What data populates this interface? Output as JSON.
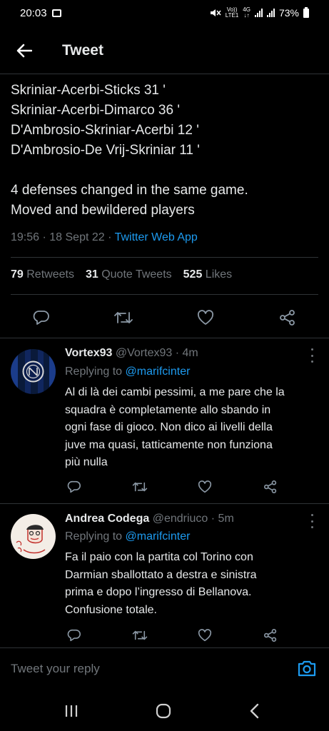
{
  "status_bar": {
    "time": "20:03",
    "volte": "Vo))",
    "lte": "LTE1",
    "network": "4G",
    "battery": "73%"
  },
  "header": {
    "title": "Tweet",
    "back_icon": "arrow-left-icon"
  },
  "tweet": {
    "lines": [
      "Skriniar-Acerbi-Sticks 31 '",
      "Skriniar-Acerbi-Dimarco 36 '",
      "D'Ambrosio-Skriniar-Acerbi 12 '",
      "D'Ambrosio-De Vrij-Skriniar 11 '",
      "4 defenses changed in the same game.",
      "Moved and bewildered players"
    ],
    "timestamp": "19:56 · 18 Sept 22 · ",
    "source": "Twitter Web App",
    "stats": {
      "retweets_count": "79",
      "retweets_label": "Retweets",
      "quotes_count": "31",
      "quotes_label": "Quote Tweets",
      "likes_count": "525",
      "likes_label": "Likes"
    }
  },
  "replies": [
    {
      "name": "Vortex93",
      "handle": "@Vortex93",
      "time": "· 4m",
      "replying_label": "Replying to ",
      "replying_to": "@marifcinter",
      "text_lines": [
        "Al di là dei cambi pessimi, a me pare che la",
        "squadra è completamente allo sbando in",
        "ogni fase di gioco. Non dico ai livelli della",
        "juve ma quasi, tatticamente non funziona",
        "più nulla"
      ]
    },
    {
      "name": "Andrea Codega",
      "handle": "@endriuco",
      "time": "· 5m",
      "replying_label": "Replying to ",
      "replying_to": "@marifcinter",
      "text_lines": [
        "Fa il paio con la partita col Torino con",
        "Darmian sballottato a destra e sinistra",
        "prima e dopo l’ingresso di Bellanova.",
        "Confusione totale."
      ]
    }
  ],
  "composer": {
    "placeholder": "Tweet your reply"
  },
  "colors": {
    "background": "#000000",
    "accent": "#1d9bf0",
    "text_primary": "#e7e9ea",
    "text_secondary": "#71767b",
    "divider": "#2f3336"
  }
}
